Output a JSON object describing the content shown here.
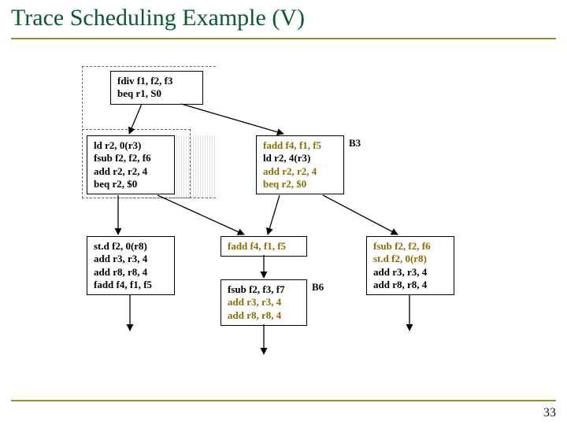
{
  "slide": {
    "title": "Trace Scheduling Example (V)",
    "page_number": "33"
  },
  "labels": {
    "b3": "B3",
    "b6": "B6"
  },
  "blocks": {
    "b1": {
      "l1": "fdiv  f1, f2, f3",
      "l2": "beq  r1,  S0"
    },
    "b2": {
      "l1": "ld   r2,  0(r3)",
      "l2": "fsub  f2, f2, f6",
      "l3": "add  r2, r2, 4",
      "l4": "beq  r2, $0"
    },
    "b3": {
      "l1": "fadd  f4, f1, f5",
      "l2": "ld   r2,  4(r3)",
      "l3": "add  r2, r2, 4",
      "l4": "beq  r2, $0"
    },
    "b4": {
      "l1": "st.d  f2, 0(r8)",
      "l2": "add  r3, r3, 4",
      "l3": "add  r8, r8, 4",
      "l4": "fadd  f4, f1, f5"
    },
    "b5": {
      "l1": "fadd  f4, f1, f5"
    },
    "b6": {
      "l1": "fsub  f2, f3, f7",
      "l2": "add  r3, r3, 4",
      "l3": "add  r8, r8, 4"
    },
    "b7": {
      "l1": "fsub  f2, f2, f6",
      "l2": "st.d  f2, 0(r8)",
      "l3": "add  r3, r3, 4",
      "l4": "add  r8, r8, 4"
    }
  }
}
